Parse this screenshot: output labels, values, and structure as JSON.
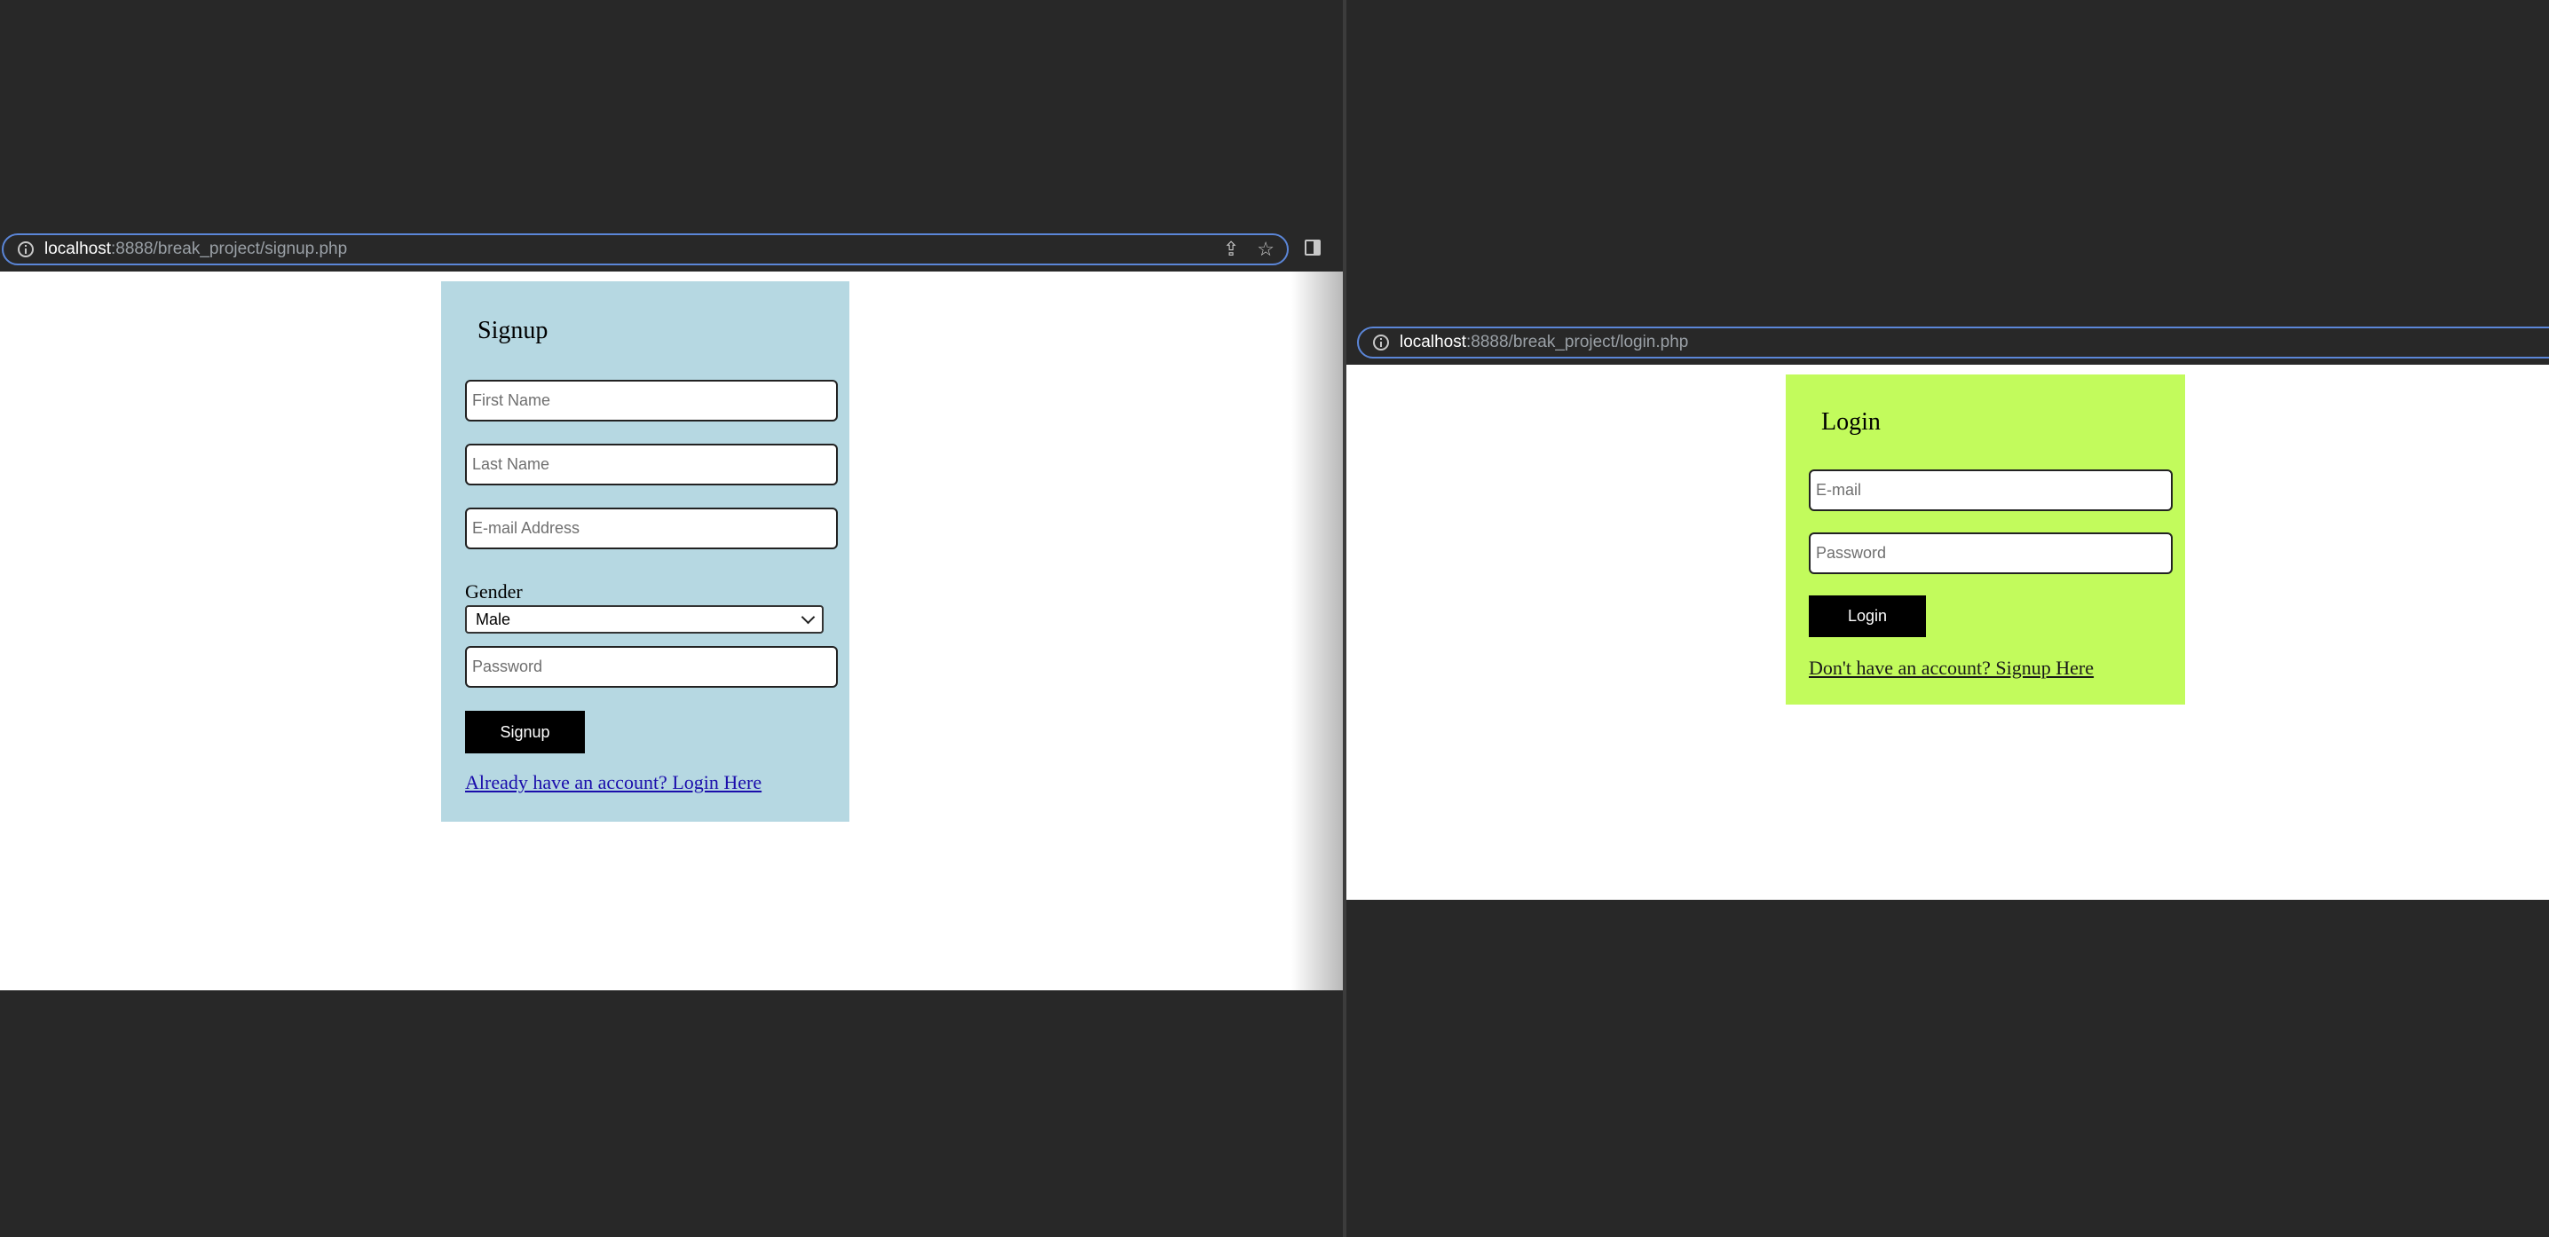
{
  "signup_window": {
    "address_bar": {
      "host": "localhost",
      "path": ":8888/break_project/signup.php"
    },
    "form": {
      "title": "Signup",
      "first_name_placeholder": "First Name",
      "last_name_placeholder": "Last Name",
      "email_placeholder": "E-mail Address",
      "gender_label": "Gender",
      "gender_selected": "Male",
      "password_placeholder": "Password",
      "submit_label": "Signup",
      "login_link": "Already have an account? Login Here"
    },
    "card_color": "#b6d8e2"
  },
  "login_window": {
    "address_bar": {
      "host": "localhost",
      "path": ":8888/break_project/login.php"
    },
    "form": {
      "title": "Login",
      "email_placeholder": "E-mail",
      "password_placeholder": "Password",
      "submit_label": "Login",
      "signup_link": "Don't have an account? Signup Here"
    },
    "card_color": "#c2fb5c"
  },
  "icons": [
    "info-icon",
    "share-icon",
    "star-icon",
    "side-panel-icon",
    "chevron-down-icon"
  ]
}
